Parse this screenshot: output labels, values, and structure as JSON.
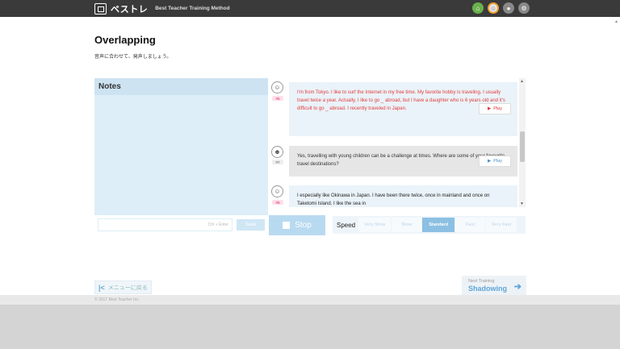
{
  "header": {
    "logo_text": "ベストレ",
    "logo_sub": "Best Teacher Training Method",
    "icons": [
      "home-icon",
      "support-icon",
      "mic-icon",
      "settings-icon"
    ]
  },
  "page": {
    "title": "Overlapping",
    "subtitle": "音声に合わせて、発声しましょう。"
  },
  "notes": {
    "heading": "Notes",
    "input_placeholder": "Ctrl + Enter",
    "save_label": "Save"
  },
  "conversation": [
    {
      "badge": "#6",
      "speaker": "user",
      "text": "I'm from Tokyo. I like to surf the Internet in my free time. My favorite hobby is traveling. I usually travel twice a year. Actually, I like to go _ abroad, but I have a daughter who is 6 years old and it's difficult to go _ abroad. I recently traveled in Japan.",
      "play": "Play"
    },
    {
      "badge": "#7",
      "speaker": "teacher",
      "text": "Yes, travelling with young children can be a challenge at times. Where are some of your favourite travel destinations?",
      "play": "Play"
    },
    {
      "badge": "#8",
      "speaker": "user",
      "text": "I especially like Okinawa in Japan. I have been there twice, once in mainland and once on Taketomi Island. I like the sea in",
      "play": ""
    }
  ],
  "controls": {
    "stop_label": "Stop",
    "speed_label": "Speed",
    "speed_options": [
      "Very Slow",
      "Slow",
      "Standard",
      "Fast",
      "Very Fast"
    ],
    "speed_selected": "Standard"
  },
  "nav": {
    "back_label": "メニューに戻る",
    "next_sub": "Next Training",
    "next_title": "Shadowing"
  },
  "footer": {
    "copyright": "© 2017 Best Teacher Inc."
  },
  "colors": {
    "accent": "#5ea5d9",
    "user_text": "#e33b3b",
    "topbar": "#3a3a3a"
  }
}
